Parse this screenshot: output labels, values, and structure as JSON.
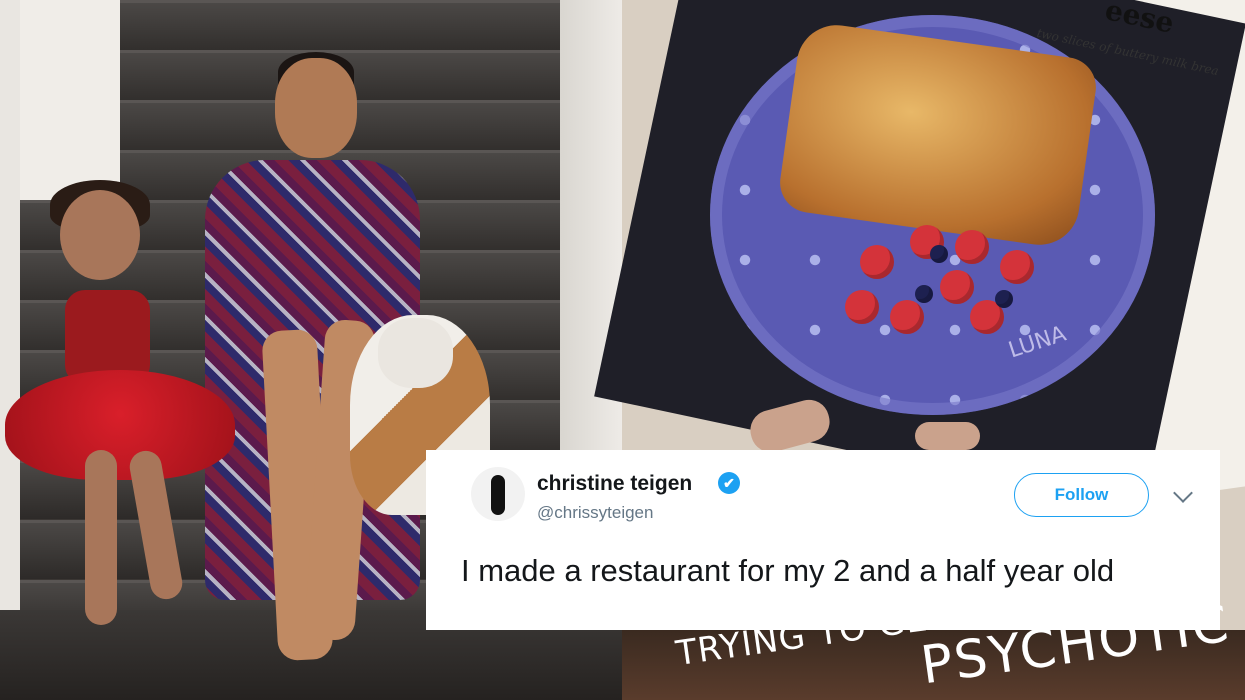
{
  "tweet": {
    "display_name": "christine teigen",
    "handle": "@chrissyteigen",
    "follow_label": "Follow",
    "text": "I made a restaurant for my 2 and a half year old",
    "verified_icon": "✔",
    "colors": {
      "accent": "#1da1f2",
      "text": "#14171a",
      "muted": "#657786"
    }
  },
  "right_photo": {
    "menu_heading": "eese",
    "menu_subtext": "two slices of buttery milk brea",
    "plate_name": "LUNA",
    "story_text_1": "TRYING TO GET",
    "story_text_2": "PSYCHOTIC"
  }
}
